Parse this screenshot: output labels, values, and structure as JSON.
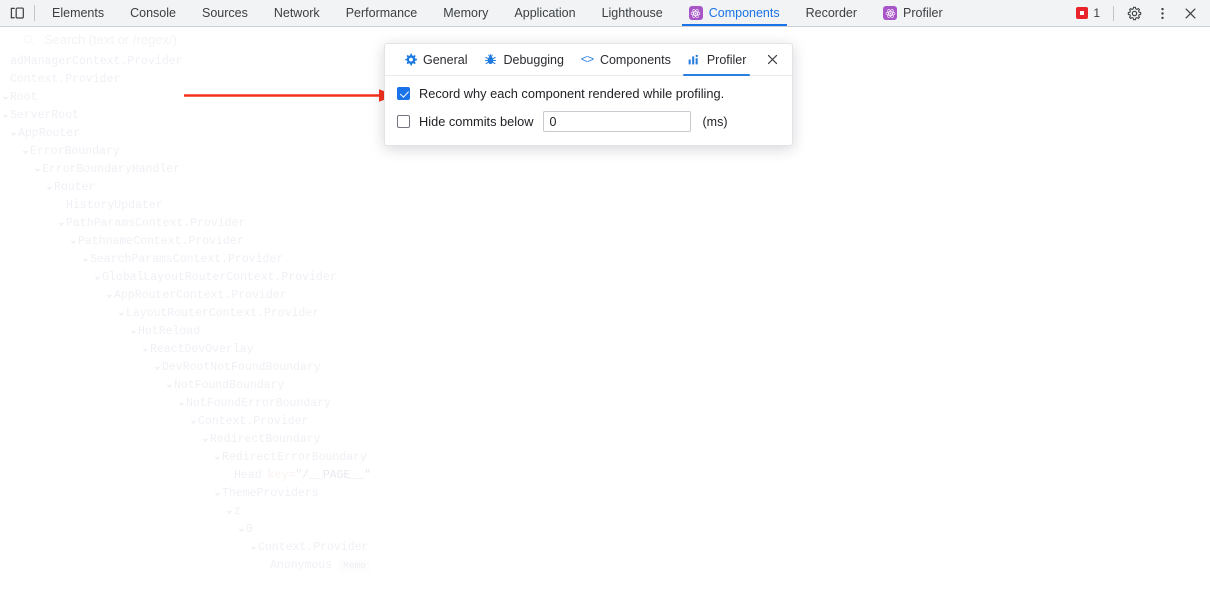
{
  "devtools_toolbar": {
    "inspect_icon": "inspect-element-icon",
    "tabs": [
      {
        "label": "Elements",
        "icon": null,
        "active": false
      },
      {
        "label": "Console",
        "icon": null,
        "active": false
      },
      {
        "label": "Sources",
        "icon": null,
        "active": false
      },
      {
        "label": "Network",
        "icon": null,
        "active": false
      },
      {
        "label": "Performance",
        "icon": null,
        "active": false
      },
      {
        "label": "Memory",
        "icon": null,
        "active": false
      },
      {
        "label": "Application",
        "icon": null,
        "active": false
      },
      {
        "label": "Lighthouse",
        "icon": null,
        "active": false
      },
      {
        "label": "Components",
        "icon": "react-icon",
        "active": true
      },
      {
        "label": "Recorder",
        "icon": null,
        "active": false
      },
      {
        "label": "Profiler",
        "icon": "react-icon",
        "active": false
      }
    ],
    "error_count": "1",
    "settings_icon": "gear-icon",
    "more_icon": "kebab-menu-icon",
    "close_icon": "close-icon",
    "accent_color": "#1a73e8",
    "error_color": "#e8232a",
    "react_icon_color": "#a855c8"
  },
  "search": {
    "icon": "search-icon",
    "placeholder": "Search (text or /regex/)",
    "value": ""
  },
  "tree": {
    "rows": [
      {
        "name": "adManagerContext.Provider",
        "depth": 0,
        "arrow": "none",
        "clipped": true
      },
      {
        "name": "Context.Provider",
        "depth": 0,
        "arrow": "none",
        "clipped": true
      },
      {
        "name": "Root",
        "depth": 0,
        "arrow": "expanded"
      },
      {
        "name": "ServerRoot",
        "depth": 1,
        "arrow": "expanded"
      },
      {
        "name": "AppRouter",
        "depth": 2,
        "arrow": "expanded"
      },
      {
        "name": "ErrorBoundary",
        "depth": 3,
        "arrow": "expanded"
      },
      {
        "name": "ErrorBoundaryHandler",
        "depth": 4,
        "arrow": "expanded"
      },
      {
        "name": "Router",
        "depth": 5,
        "arrow": "expanded"
      },
      {
        "name": "HistoryUpdater",
        "depth": 6,
        "arrow": "none"
      },
      {
        "name": "PathParamsContext.Provider",
        "depth": 6,
        "arrow": "expanded"
      },
      {
        "name": "PathnameContext.Provider",
        "depth": 7,
        "arrow": "expanded"
      },
      {
        "name": "SearchParamsContext.Provider",
        "depth": 8,
        "arrow": "expanded"
      },
      {
        "name": "GlobalLayoutRouterContext.Provider",
        "depth": 9,
        "arrow": "expanded"
      },
      {
        "name": "AppRouterContext.Provider",
        "depth": 10,
        "arrow": "expanded"
      },
      {
        "name": "LayoutRouterContext.Provider",
        "depth": 11,
        "arrow": "expanded"
      },
      {
        "name": "HotReload",
        "depth": 12,
        "arrow": "expanded"
      },
      {
        "name": "ReactDevOverlay",
        "depth": 13,
        "arrow": "expanded"
      },
      {
        "name": "DevRootNotFoundBoundary",
        "depth": 14,
        "arrow": "expanded"
      },
      {
        "name": "NotFoundBoundary",
        "depth": 15,
        "arrow": "expanded"
      },
      {
        "name": "NotFoundErrorBoundary",
        "depth": 16,
        "arrow": "expanded"
      },
      {
        "name": "Context.Provider",
        "depth": 17,
        "arrow": "expanded"
      },
      {
        "name": "RedirectBoundary",
        "depth": 18,
        "arrow": "expanded"
      },
      {
        "name": "RedirectErrorBoundary",
        "depth": 19,
        "arrow": "expanded"
      },
      {
        "name": "Head",
        "depth": 20,
        "arrow": "none",
        "key_name": "key",
        "key_value": "\"/__PAGE__\""
      },
      {
        "name": "ThemeProviders",
        "depth": 19,
        "arrow": "expanded"
      },
      {
        "name": "z",
        "depth": 20,
        "arrow": "expanded"
      },
      {
        "name": "0",
        "depth": 21,
        "arrow": "expanded"
      },
      {
        "name": "Context.Provider",
        "depth": 22,
        "arrow": "expanded"
      },
      {
        "name": "Anonymous",
        "depth": 23,
        "arrow": "none",
        "badge": "Memo"
      }
    ]
  },
  "settings_modal": {
    "tabs": [
      {
        "label": "General",
        "icon": "gear-icon",
        "active": false
      },
      {
        "label": "Debugging",
        "icon": "bug-icon",
        "active": false
      },
      {
        "label": "Components",
        "icon": "code-brackets-icon",
        "active": false
      },
      {
        "label": "Profiler",
        "icon": "bar-chart-icon",
        "active": true
      }
    ],
    "close_icon": "close-icon",
    "record_why": {
      "label": "Record why each component rendered while profiling.",
      "checked": true
    },
    "hide_commits": {
      "label": "Hide commits below",
      "checked": false,
      "value": "0",
      "unit": "(ms)"
    },
    "accent_color": "#2a7fe0"
  },
  "annotation": {
    "type": "arrow",
    "color": "#f5311d",
    "points_to": "record-why-checkbox"
  }
}
